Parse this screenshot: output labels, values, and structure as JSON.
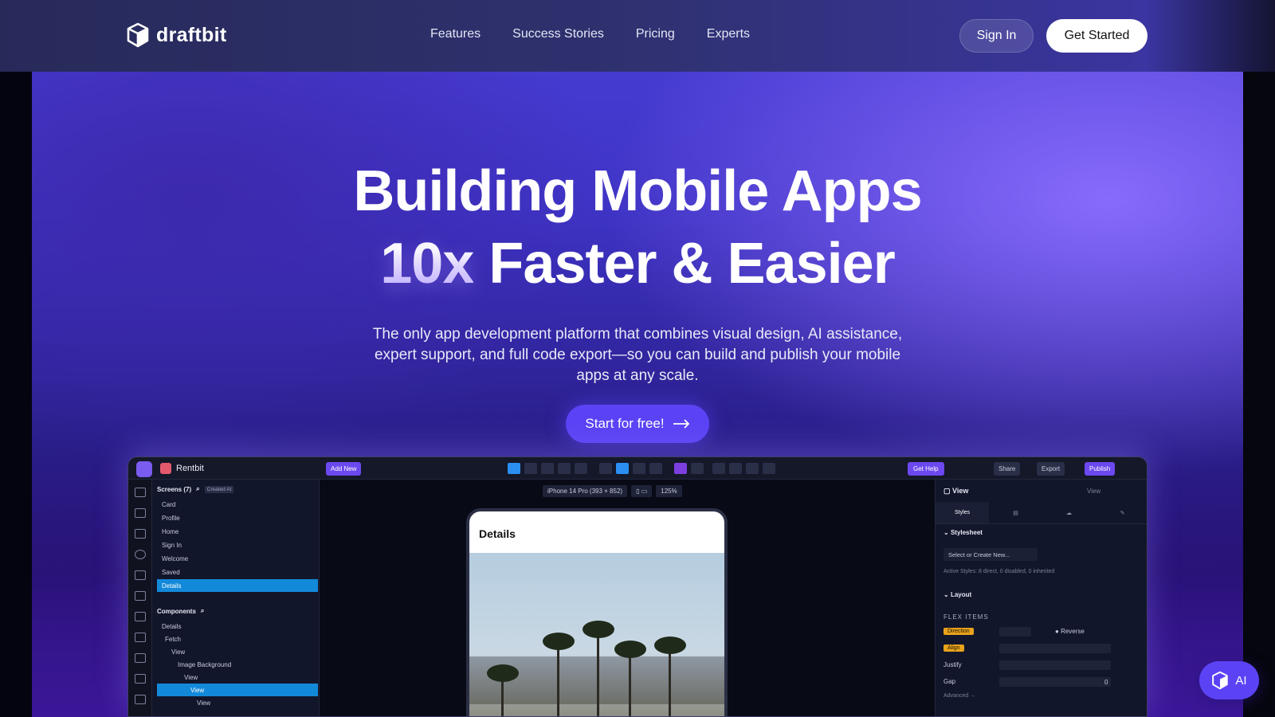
{
  "nav": {
    "brand": "draftbit",
    "links": [
      "Features",
      "Success Stories",
      "Pricing",
      "Experts"
    ],
    "sign_in": "Sign In",
    "get_started": "Get Started"
  },
  "hero": {
    "title_line1": "Building Mobile Apps",
    "title_highlight": "10x",
    "title_line2_rest": "Faster & Easier",
    "subtitle": "The only app development platform that combines visual design, AI assistance, expert support, and full code export—so you can build and publish your mobile apps at any scale.",
    "cta": "Start for free!"
  },
  "app_preview": {
    "project_name": "Rentbit",
    "add_new": "Add New",
    "get_help": "Get Help",
    "share": "Share",
    "export": "Export",
    "publish": "Publish",
    "device_select": "iPhone 14 Pro (393 × 852)",
    "zoom": "125%",
    "screens_header": "Screens (7)",
    "screens_badge": "Created At",
    "screens": [
      "Card",
      "Profile",
      "Home",
      "Sign In",
      "Welcome",
      "Saved",
      "Details"
    ],
    "selected_screen": "Details",
    "components_header": "Components",
    "components": [
      "Details",
      "Fetch",
      "View",
      "Image Background",
      "View",
      "View",
      "View"
    ],
    "phone_title": "Details",
    "inspector": {
      "element": "View",
      "element_right": "View",
      "tab_styles": "Styles",
      "stylesheet": "Stylesheet",
      "stylesheet_select": "Select or Create New...",
      "active_styles": "Active Styles: 8 direct, 0 disabled, 0 inherited",
      "layout": "Layout",
      "flex_items": "FLEX ITEMS",
      "direction": "Direction",
      "reverse": "Reverse",
      "align": "Align",
      "justify": "Justify",
      "gap": "Gap",
      "gap_value": "0",
      "advanced": "Advanced →"
    }
  },
  "ai_button": "AI",
  "colors": {
    "accent": "#5b43f5",
    "selected_row": "#1389d9",
    "badge_orange": "#e8a21c"
  }
}
